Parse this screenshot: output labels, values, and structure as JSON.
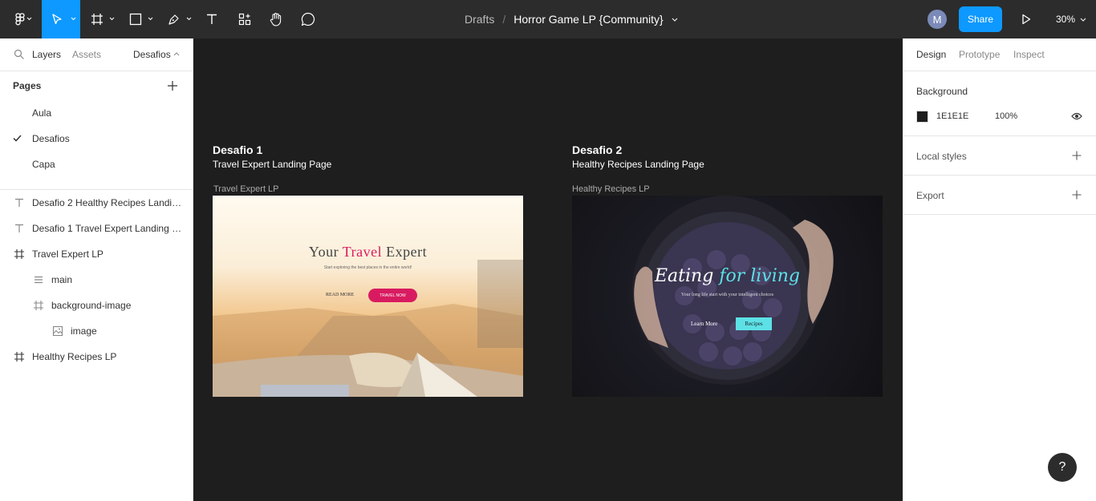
{
  "toolbar": {
    "breadcrumb_parent": "Drafts",
    "file_name": "Horror Game LP {Community}",
    "avatar_initial": "M",
    "share_label": "Share",
    "zoom_level": "30%",
    "tools": [
      "main-menu",
      "move",
      "frame",
      "shape",
      "pen",
      "text",
      "resources",
      "hand",
      "comment"
    ],
    "accent": "#0d99ff"
  },
  "left_panel": {
    "tabs": [
      "Layers",
      "Assets"
    ],
    "current_page": "Desafios",
    "pages_heading": "Pages",
    "pages": [
      {
        "label": "Aula",
        "selected": false
      },
      {
        "label": "Desafios",
        "selected": true
      },
      {
        "label": "Capa",
        "selected": false
      }
    ],
    "layers": [
      {
        "label": "Desafio 2 Healthy Recipes Landing Page",
        "icon": "text-icon"
      },
      {
        "label": "Desafio 1 Travel Expert Landing Page",
        "icon": "text-icon"
      },
      {
        "label": "Travel Expert LP",
        "icon": "frame-icon"
      },
      {
        "label": "main",
        "icon": "auto-layout-icon"
      },
      {
        "label": "background-image",
        "icon": "frame-icon"
      },
      {
        "label": "image",
        "icon": "image-icon"
      },
      {
        "label": "Healthy Recipes LP",
        "icon": "frame-icon"
      }
    ]
  },
  "canvas": {
    "background": "#1e1e1e",
    "challenges": [
      {
        "title": "Desafio 1",
        "subtitle": "Travel Expert Landing Page",
        "frame_label": "Travel Expert LP",
        "hero": {
          "heading_a": "Your ",
          "heading_b": "Travel",
          "heading_c": " Expert",
          "tagline": "Start exploring the best places in the entire world!",
          "link": "READ MORE",
          "button": "TRAVEL NOW"
        }
      },
      {
        "title": "Desafio 2",
        "subtitle": "Healthy Recipes Landing Page",
        "frame_label": "Healthy Recipes LP",
        "hero": {
          "heading_a": "Eating ",
          "heading_b": "for living",
          "tagline": "Your long life start with  your intelligent choices",
          "link": "Learn More",
          "button": "Recipes"
        }
      }
    ]
  },
  "right_panel": {
    "tabs": [
      "Design",
      "Prototype",
      "Inspect"
    ],
    "background_heading": "Background",
    "background_hex": "1E1E1E",
    "background_opacity": "100%",
    "local_styles": "Local styles",
    "export": "Export"
  },
  "help": "?"
}
